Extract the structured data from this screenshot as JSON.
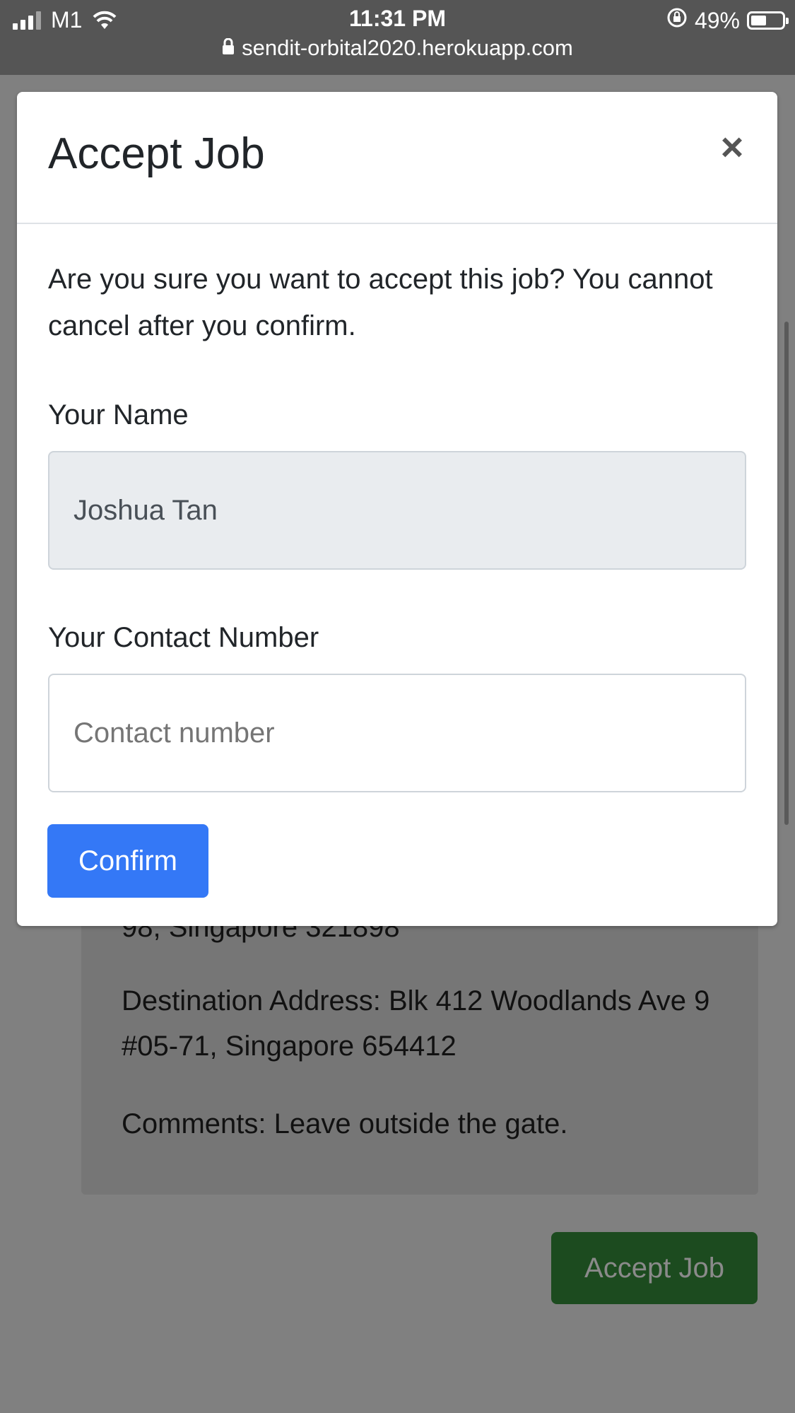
{
  "status_bar": {
    "carrier": "M1",
    "time": "11:31 PM",
    "battery_percent": "49%",
    "battery_level": 0.49,
    "url": "sendit-orbital2020.herokuapp.com"
  },
  "background_card": {
    "pickup_tail": "98, Singapore 321898",
    "destination": "Destination Address: Blk 412 Woodlands Ave 9 #05-71, Singapore 654412",
    "comments": "Comments: Leave outside the gate."
  },
  "background_button": {
    "label": "Accept Job"
  },
  "modal": {
    "title": "Accept Job",
    "close_label": "×",
    "message": "Are you sure you want to accept this job? You cannot cancel after you confirm.",
    "name_label": "Your Name",
    "name_value": "Joshua Tan",
    "contact_label": "Your Contact Number",
    "contact_placeholder": "Contact number",
    "confirm_label": "Confirm"
  },
  "colors": {
    "primary": "#3478f6",
    "success": "#1c4b1f",
    "backdrop": "#808080"
  }
}
